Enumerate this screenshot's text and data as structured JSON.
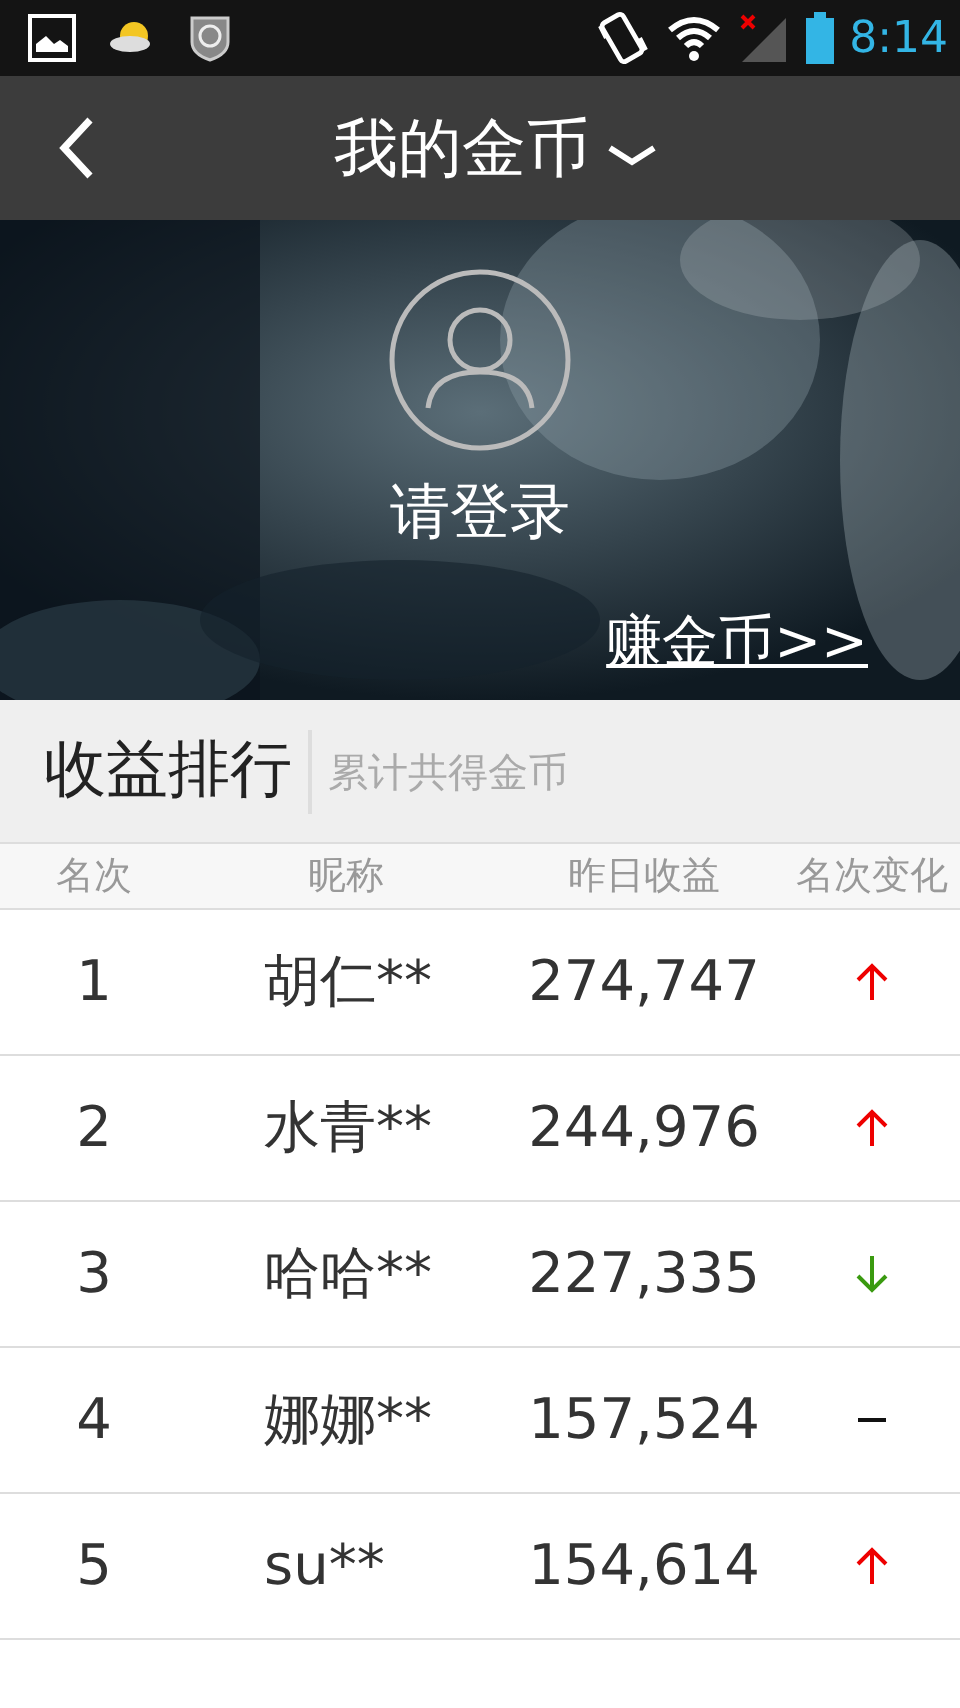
{
  "status_bar": {
    "time": "8:14"
  },
  "header": {
    "title": "我的金币"
  },
  "banner": {
    "login_text": "请登录",
    "earn_link": "赚金币>>"
  },
  "ranking": {
    "title": "收益排行",
    "subtitle": "累计共得金币",
    "columns": [
      "名次",
      "昵称",
      "昨日收益",
      "名次变化"
    ],
    "rows": [
      {
        "rank": "1",
        "name": "胡仁**",
        "amount": "274,747",
        "kind": "up"
      },
      {
        "rank": "2",
        "name": "水青**",
        "amount": "244,976",
        "kind": "up"
      },
      {
        "rank": "3",
        "name": "哈哈**",
        "amount": "227,335",
        "kind": "down"
      },
      {
        "rank": "4",
        "name": "娜娜**",
        "amount": "157,524",
        "kind": "same"
      },
      {
        "rank": "5",
        "name": "su**",
        "amount": "154,614",
        "kind": "up"
      }
    ]
  }
}
